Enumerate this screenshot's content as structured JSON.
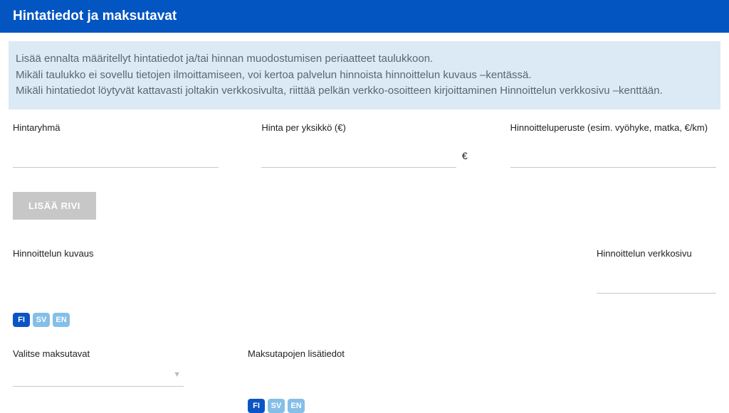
{
  "header": {
    "title": "Hintatiedot ja maksutavat"
  },
  "info": {
    "line1": "Lisää ennalta määritellyt hintatiedot ja/tai hinnan muodostumisen periaatteet taulukkoon.",
    "line2": "Mikäli taulukko ei sovellu tietojen ilmoittamiseen, voi kertoa palvelun hinnoista hinnoittelun kuvaus –kentässä.",
    "line3": "Mikäli hintatiedot löytyvät kattavasti joltakin verkkosivulta, riittää pelkän verkko-osoitteen kirjoittaminen Hinnoittelun verkkosivu –kenttään."
  },
  "labels": {
    "hintaryhma": "Hintaryhmä",
    "hinta_per_yksikko": "Hinta per yksikkö (€)",
    "hinnoitteluperuste": "Hinnoitteluperuste (esim. vyöhyke, matka, €/km)",
    "hinnoittelun_kuvaus": "Hinnoittelun kuvaus",
    "hinnoittelun_verkkosivu": "Hinnoittelun verkkosivu",
    "valitse_maksutavat": "Valitse maksutavat",
    "maksutapojen_lisatiedot": "Maksutapojen lisätiedot"
  },
  "values": {
    "hintaryhma": "",
    "hinta": "",
    "hinnoitteluperuste": "",
    "hinnoittelun_kuvaus": "",
    "hinnoittelun_verkkosivu": "",
    "maksutavat": "",
    "maksutapojen_lisatiedot": ""
  },
  "euro_symbol": "€",
  "buttons": {
    "add_row": "LISÄÄ RIVI"
  },
  "lang": {
    "fi": "FI",
    "sv": "SV",
    "en": "EN"
  }
}
